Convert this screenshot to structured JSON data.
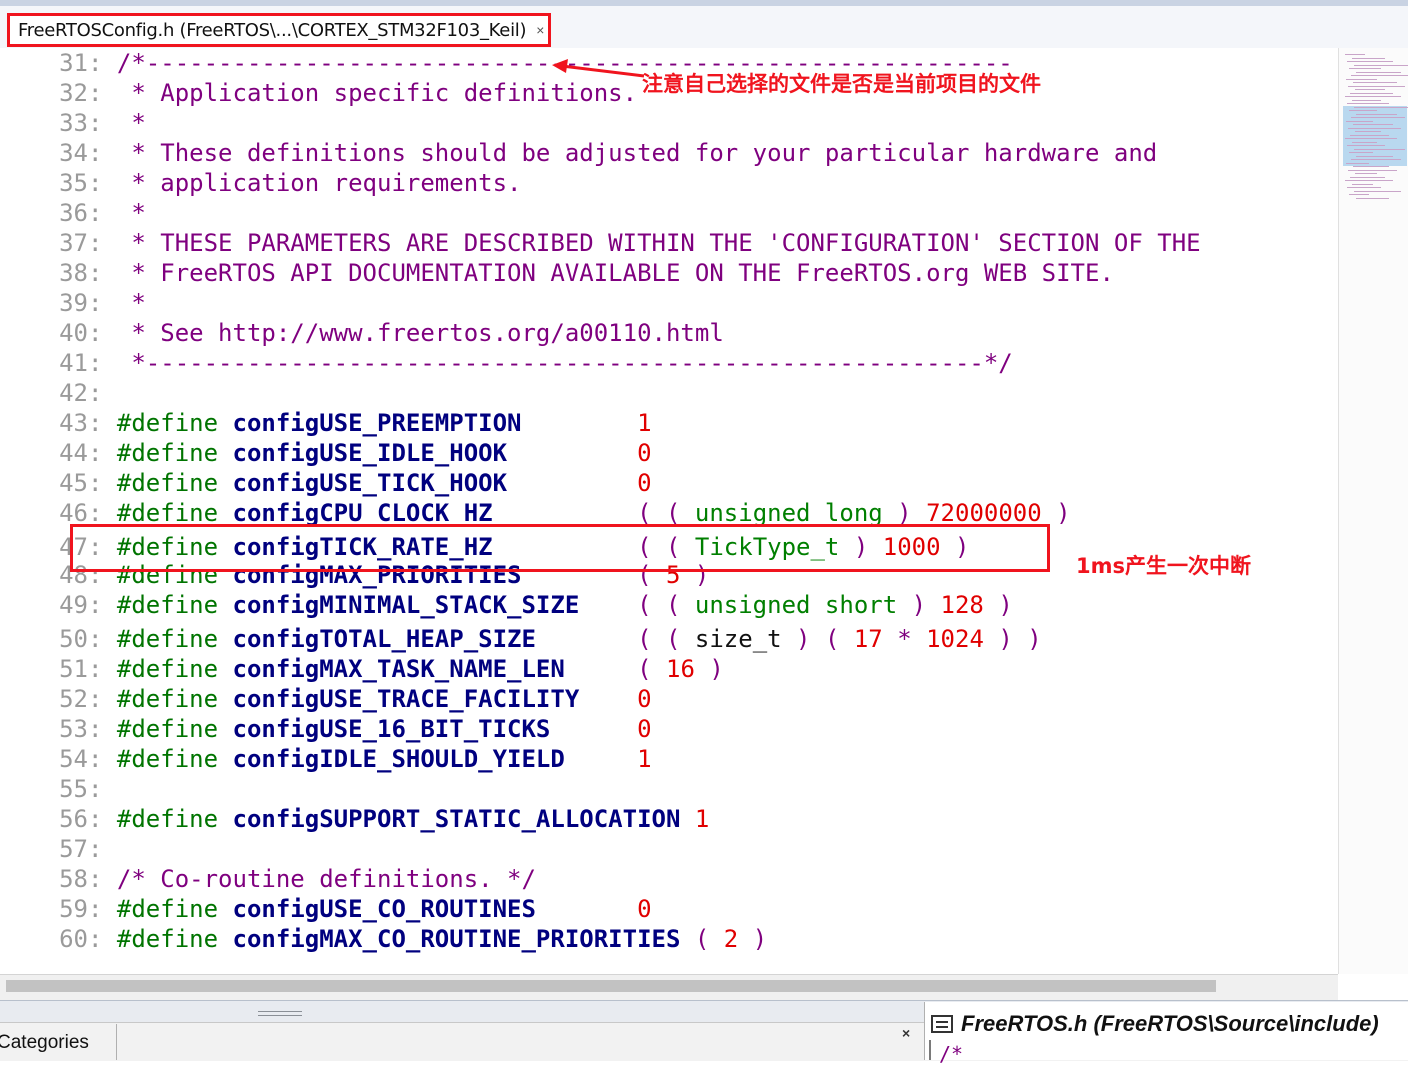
{
  "tab": {
    "title": "FreeRTOSConfig.h (FreeRTOS\\...\\CORTEX_STM32F103_Keil)",
    "close": "×"
  },
  "annotations": {
    "file_note": "注意自己选择的文件是否是当前项目的文件",
    "tick_note": "1ms产生一次中断",
    "highlight_color": "#f0141e"
  },
  "code_lines": [
    {
      "n": "31",
      "parts": [
        {
          "c": "cm",
          "t": "/*------------------------------------------------------------"
        }
      ]
    },
    {
      "n": "32",
      "parts": [
        {
          "c": "cm",
          "t": " * Application specific definitions."
        }
      ]
    },
    {
      "n": "33",
      "parts": [
        {
          "c": "cm",
          "t": " *"
        }
      ]
    },
    {
      "n": "34",
      "parts": [
        {
          "c": "cm",
          "t": " * These definitions should be adjusted for your particular hardware and"
        }
      ]
    },
    {
      "n": "35",
      "parts": [
        {
          "c": "cm",
          "t": " * application requirements."
        }
      ]
    },
    {
      "n": "36",
      "parts": [
        {
          "c": "cm",
          "t": " *"
        }
      ]
    },
    {
      "n": "37",
      "parts": [
        {
          "c": "cm",
          "t": " * THESE PARAMETERS ARE DESCRIBED WITHIN THE 'CONFIGURATION' SECTION OF THE"
        }
      ]
    },
    {
      "n": "38",
      "parts": [
        {
          "c": "cm",
          "t": " * FreeRTOS API DOCUMENTATION AVAILABLE ON THE FreeRTOS.org WEB SITE."
        }
      ]
    },
    {
      "n": "39",
      "parts": [
        {
          "c": "cm",
          "t": " *"
        }
      ]
    },
    {
      "n": "40",
      "parts": [
        {
          "c": "cm",
          "t": " * See http://www.freertos.org/a00110.html"
        }
      ]
    },
    {
      "n": "41",
      "parts": [
        {
          "c": "cm",
          "t": " *----------------------------------------------------------*/"
        }
      ]
    },
    {
      "n": "42",
      "parts": []
    },
    {
      "n": "43",
      "parts": [
        {
          "c": "kw",
          "t": "#define "
        },
        {
          "c": "id",
          "t": "configUSE_PREEMPTION"
        },
        {
          "c": "plain",
          "t": "        "
        },
        {
          "c": "num",
          "t": "1"
        }
      ]
    },
    {
      "n": "44",
      "parts": [
        {
          "c": "kw",
          "t": "#define "
        },
        {
          "c": "id",
          "t": "configUSE_IDLE_HOOK"
        },
        {
          "c": "plain",
          "t": "         "
        },
        {
          "c": "num",
          "t": "0"
        }
      ]
    },
    {
      "n": "45",
      "parts": [
        {
          "c": "kw",
          "t": "#define "
        },
        {
          "c": "id",
          "t": "configUSE_TICK_HOOK"
        },
        {
          "c": "plain",
          "t": "         "
        },
        {
          "c": "num",
          "t": "0"
        }
      ]
    },
    {
      "n": "46",
      "parts": [
        {
          "c": "kw",
          "t": "#define "
        },
        {
          "c": "id",
          "t": "configCPU_CLOCK_HZ"
        },
        {
          "c": "plain",
          "t": "          "
        },
        {
          "c": "pn",
          "t": "( ( "
        },
        {
          "c": "ty",
          "t": "unsigned long"
        },
        {
          "c": "pn",
          "t": " ) "
        },
        {
          "c": "num",
          "t": "72000000"
        },
        {
          "c": "pn",
          "t": " )"
        }
      ]
    },
    {
      "n": "47",
      "parts": [
        {
          "c": "kw",
          "t": "#define "
        },
        {
          "c": "id",
          "t": "configTICK_RATE_HZ"
        },
        {
          "c": "plain",
          "t": "          "
        },
        {
          "c": "pn",
          "t": "( ( "
        },
        {
          "c": "ty",
          "t": "TickType_t"
        },
        {
          "c": "pn",
          "t": " ) "
        },
        {
          "c": "num",
          "t": "1000"
        },
        {
          "c": "pn",
          "t": " )"
        }
      ]
    },
    {
      "n": "48",
      "parts": [
        {
          "c": "kw",
          "t": "#define "
        },
        {
          "c": "id",
          "t": "configMAX_PRIORITIES"
        },
        {
          "c": "plain",
          "t": "        "
        },
        {
          "c": "pn",
          "t": "( "
        },
        {
          "c": "num",
          "t": "5"
        },
        {
          "c": "pn",
          "t": " )"
        }
      ]
    },
    {
      "n": "49",
      "parts": [
        {
          "c": "kw",
          "t": "#define "
        },
        {
          "c": "id",
          "t": "configMINIMAL_STACK_SIZE"
        },
        {
          "c": "plain",
          "t": "    "
        },
        {
          "c": "pn",
          "t": "( ( "
        },
        {
          "c": "ty",
          "t": "unsigned short"
        },
        {
          "c": "pn",
          "t": " ) "
        },
        {
          "c": "num",
          "t": "128"
        },
        {
          "c": "pn",
          "t": " )"
        }
      ]
    },
    {
      "n": "50",
      "parts": [
        {
          "c": "kw",
          "t": "#define "
        },
        {
          "c": "id",
          "t": "configTOTAL_HEAP_SIZE"
        },
        {
          "c": "plain",
          "t": "       "
        },
        {
          "c": "pn",
          "t": "( ( "
        },
        {
          "c": "plain",
          "t": "size_t"
        },
        {
          "c": "pn",
          "t": " ) ( "
        },
        {
          "c": "num",
          "t": "17"
        },
        {
          "c": "pn",
          "t": " * "
        },
        {
          "c": "num",
          "t": "1024"
        },
        {
          "c": "pn",
          "t": " ) )"
        }
      ]
    },
    {
      "n": "51",
      "parts": [
        {
          "c": "kw",
          "t": "#define "
        },
        {
          "c": "id",
          "t": "configMAX_TASK_NAME_LEN"
        },
        {
          "c": "plain",
          "t": "     "
        },
        {
          "c": "pn",
          "t": "( "
        },
        {
          "c": "num",
          "t": "16"
        },
        {
          "c": "pn",
          "t": " )"
        }
      ]
    },
    {
      "n": "52",
      "parts": [
        {
          "c": "kw",
          "t": "#define "
        },
        {
          "c": "id",
          "t": "configUSE_TRACE_FACILITY"
        },
        {
          "c": "plain",
          "t": "    "
        },
        {
          "c": "num",
          "t": "0"
        }
      ]
    },
    {
      "n": "53",
      "parts": [
        {
          "c": "kw",
          "t": "#define "
        },
        {
          "c": "id",
          "t": "configUSE_16_BIT_TICKS"
        },
        {
          "c": "plain",
          "t": "      "
        },
        {
          "c": "num",
          "t": "0"
        }
      ]
    },
    {
      "n": "54",
      "parts": [
        {
          "c": "kw",
          "t": "#define "
        },
        {
          "c": "id",
          "t": "configIDLE_SHOULD_YIELD"
        },
        {
          "c": "plain",
          "t": "     "
        },
        {
          "c": "num",
          "t": "1"
        }
      ]
    },
    {
      "n": "55",
      "parts": []
    },
    {
      "n": "56",
      "parts": [
        {
          "c": "kw",
          "t": "#define "
        },
        {
          "c": "id",
          "t": "configSUPPORT_STATIC_ALLOCATION"
        },
        {
          "c": "plain",
          "t": " "
        },
        {
          "c": "num",
          "t": "1"
        }
      ]
    },
    {
      "n": "57",
      "parts": []
    },
    {
      "n": "58",
      "parts": [
        {
          "c": "cm",
          "t": "/* Co-routine definitions. */"
        }
      ]
    },
    {
      "n": "59",
      "parts": [
        {
          "c": "kw",
          "t": "#define "
        },
        {
          "c": "id",
          "t": "configUSE_CO_ROUTINES"
        },
        {
          "c": "plain",
          "t": "       "
        },
        {
          "c": "num",
          "t": "0"
        }
      ]
    },
    {
      "n": "60",
      "parts": [
        {
          "c": "kw",
          "t": "#define "
        },
        {
          "c": "id",
          "t": "configMAX_CO_ROUTINE_PRIORITIES"
        },
        {
          "c": "plain",
          "t": " "
        },
        {
          "c": "pn",
          "t": "( "
        },
        {
          "c": "num",
          "t": "2"
        },
        {
          "c": "pn",
          "t": " )"
        }
      ]
    }
  ],
  "bottom": {
    "categories_label": "Categories",
    "close": "×",
    "second_tab_title": "FreeRTOS.h (FreeRTOS\\Source\\include)",
    "second_code": "/*"
  }
}
